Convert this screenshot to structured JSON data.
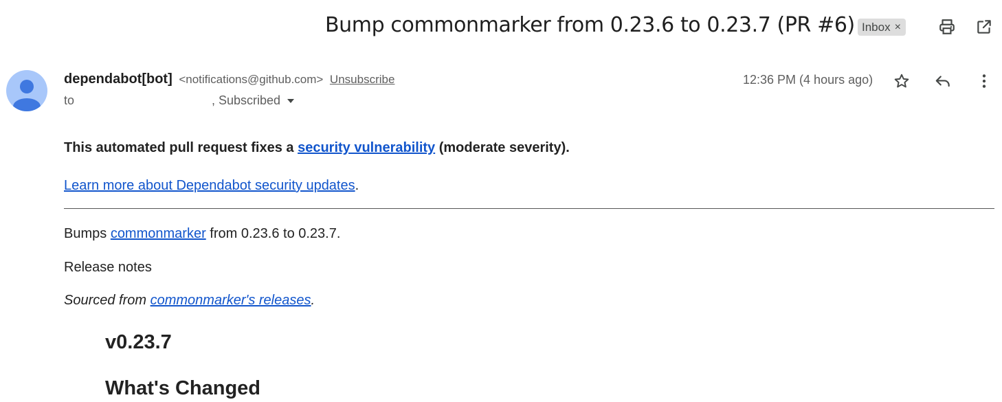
{
  "subject": "Bump commonmarker from 0.23.6 to 0.23.7 (PR #6)",
  "label": {
    "name": "Inbox",
    "remove": "×"
  },
  "toolbar": {
    "print_icon": "printer-icon",
    "popout_icon": "open-in-new-window-icon"
  },
  "sender": {
    "name": "dependabot[bot]",
    "email": "<notifications@github.com>",
    "unsubscribe": "Unsubscribe",
    "to_prefix": "to",
    "to_suffix": ", Subscribed",
    "timestamp": "12:36 PM (4 hours ago)",
    "avatar_color": "#a8c7fa",
    "avatar_figure_color": "#3f78e0"
  },
  "actions": {
    "star_icon": "star-icon",
    "reply_icon": "reply-icon",
    "more_icon": "more-vert-icon"
  },
  "body": {
    "intro_prefix": "This automated pull request fixes a ",
    "intro_link": "security vulnerability",
    "intro_suffix": " (moderate severity).",
    "learn_more_link": "Learn more about Dependabot security updates",
    "learn_more_suffix": ".",
    "bumps_prefix": "Bumps ",
    "bumps_link": "commonmarker",
    "bumps_suffix": " from 0.23.6 to 0.23.7.",
    "release_notes": "Release notes",
    "sourced_prefix": "Sourced from ",
    "sourced_link": "commonmarker's releases",
    "sourced_suffix": ".",
    "version_heading": "v0.23.7",
    "changed_heading": "What's Changed"
  },
  "colors": {
    "link": "#1155cc",
    "label_bg": "#dddddd",
    "text": "#222222",
    "muted": "#5e5e5e"
  }
}
